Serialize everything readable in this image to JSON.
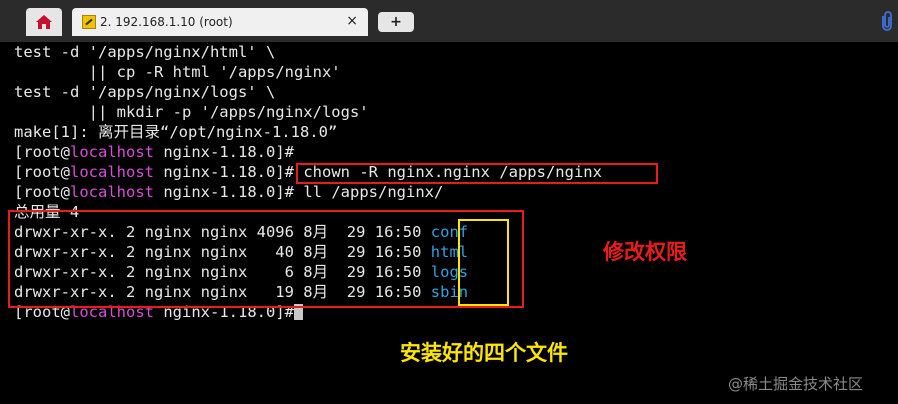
{
  "tabs": {
    "home_icon": "home-icon",
    "session_title": "2. 192.168.1.10 (root)",
    "close_glyph": "×",
    "add_glyph": "+",
    "attach_icon": "paperclip-icon"
  },
  "terminal": {
    "lines": [
      "test -d '/apps/nginx/html' \\",
      "        || cp -R html '/apps/nginx'",
      "test -d '/apps/nginx/logs' \\",
      "        || mkdir -p '/apps/nginx/logs'",
      "make[1]: 离开目录“/opt/nginx-1.18.0”"
    ],
    "prompt_user": "[root@",
    "prompt_host": "localhost",
    "prompt_dir": " nginx-1.18.0]",
    "prompt_hash": "#",
    "cmd_chown": " chown -R nginx.nginx /apps/nginx",
    "cmd_ll": " ll /apps/nginx/",
    "total": "总用量 4",
    "entries": [
      {
        "meta": "drwxr-xr-x. 2 nginx nginx 4096 8月  29 16:50 ",
        "name": "conf"
      },
      {
        "meta": "drwxr-xr-x. 2 nginx nginx   40 8月  29 16:50 ",
        "name": "html"
      },
      {
        "meta": "drwxr-xr-x. 2 nginx nginx    6 8月  29 16:50 ",
        "name": "logs"
      },
      {
        "meta": "drwxr-xr-x. 2 nginx nginx   19 8月  29 16:50 ",
        "name": "sbin"
      }
    ]
  },
  "annotations": {
    "permission_note": "修改权限",
    "files_note": "安装好的四个文件",
    "watermark": "@稀土掘金技术社区"
  },
  "colors": {
    "host": "#d64fd6",
    "dir_name": "#33a1e0",
    "red_box": "#e81c1c",
    "yellow_box": "#ffe600"
  }
}
